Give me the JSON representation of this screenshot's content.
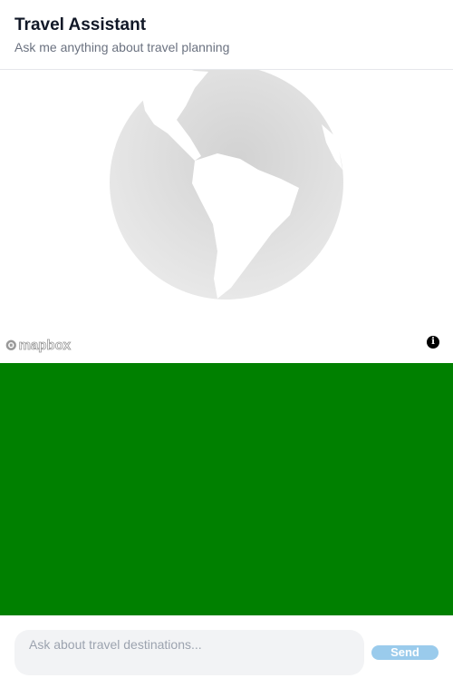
{
  "header": {
    "title": "Travel Assistant",
    "subtitle": "Ask me anything about travel planning"
  },
  "map": {
    "attribution_logo": "mapbox",
    "info_icon": "info-icon"
  },
  "panel": {
    "color": "#008000"
  },
  "chat": {
    "placeholder": "Ask about travel destinations...",
    "send_label": "Send",
    "send_color": "#9acbec"
  }
}
